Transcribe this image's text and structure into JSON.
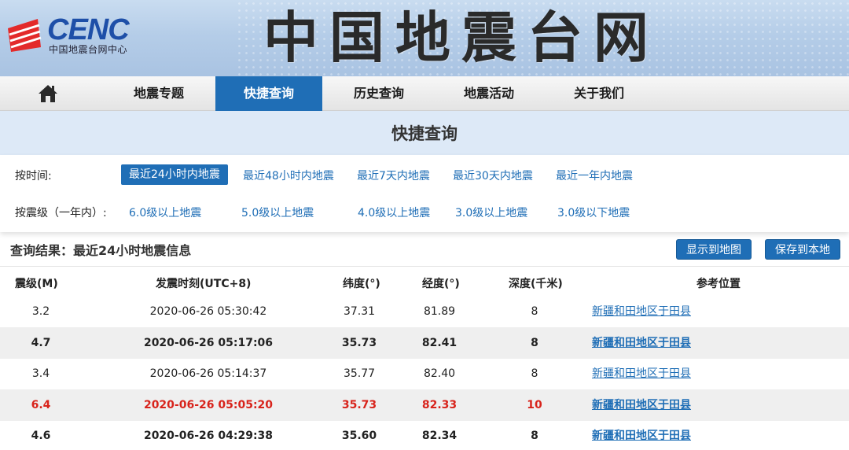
{
  "header": {
    "logo_text": "CENC",
    "logo_subtitle": "中国地震台网中心",
    "site_title": "中国地震台网"
  },
  "nav": {
    "items": [
      {
        "label": "地震专题"
      },
      {
        "label": "快捷查询",
        "active": true
      },
      {
        "label": "历史查询"
      },
      {
        "label": "地震活动"
      },
      {
        "label": "关于我们"
      }
    ]
  },
  "quick_query": {
    "title": "快捷查询",
    "by_time_label": "按时间:",
    "time_options": [
      "最近24小时内地震",
      "最近48小时内地震",
      "最近7天内地震",
      "最近30天内地震",
      "最近一年内地震"
    ],
    "selected_time": "最近24小时内地震",
    "by_magnitude_label": "按震级（一年内）:",
    "magnitude_options": [
      "6.0级以上地震",
      "5.0级以上地震",
      "4.0级以上地震",
      "3.0级以上地震",
      "3.0级以下地震"
    ]
  },
  "results": {
    "title": "查询结果：最近24小时地震信息",
    "show_map_label": "显示到地图",
    "save_local_label": "保存到本地",
    "columns": [
      "震级(M)",
      "发震时刻(UTC+8)",
      "纬度(°)",
      "经度(°)",
      "深度(千米)",
      "参考位置"
    ],
    "rows": [
      {
        "mag": "3.2",
        "time": "2020-06-26 05:30:42",
        "lat": "37.31",
        "lon": "81.89",
        "depth": "8",
        "location": "新疆和田地区于田县",
        "style": "normal"
      },
      {
        "mag": "4.7",
        "time": "2020-06-26 05:17:06",
        "lat": "35.73",
        "lon": "82.41",
        "depth": "8",
        "location": "新疆和田地区于田县",
        "style": "bold"
      },
      {
        "mag": "3.4",
        "time": "2020-06-26 05:14:37",
        "lat": "35.77",
        "lon": "82.40",
        "depth": "8",
        "location": "新疆和田地区于田县",
        "style": "normal"
      },
      {
        "mag": "6.4",
        "time": "2020-06-26 05:05:20",
        "lat": "35.73",
        "lon": "82.33",
        "depth": "10",
        "location": "新疆和田地区于田县",
        "style": "red"
      },
      {
        "mag": "4.6",
        "time": "2020-06-26 04:29:38",
        "lat": "35.60",
        "lon": "82.34",
        "depth": "8",
        "location": "新疆和田地区于田县",
        "style": "bold"
      }
    ]
  },
  "colors": {
    "accent": "#1f6eb6",
    "highlight_red": "#d8231b",
    "logo_red": "#e32a2a",
    "logo_blue": "#1e4fa8"
  },
  "icons": {
    "home": "home-icon",
    "logo": "cenc-logo-icon"
  }
}
